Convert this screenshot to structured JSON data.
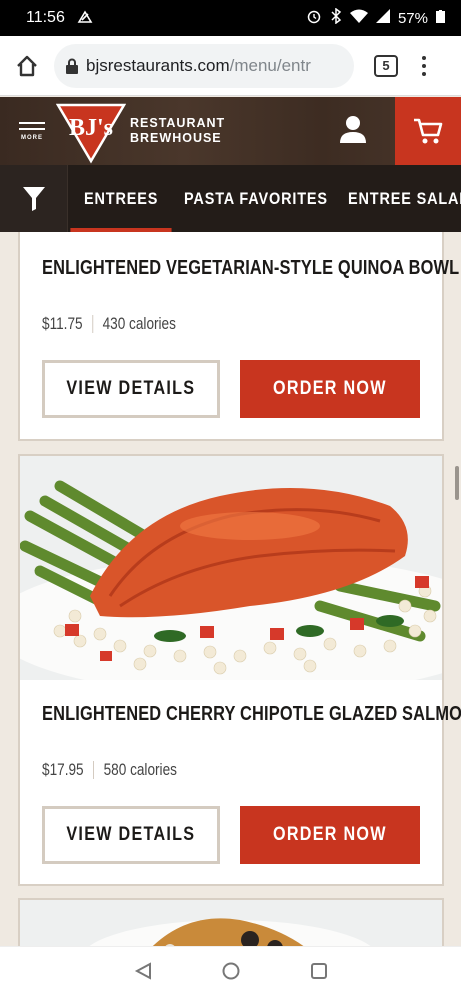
{
  "status_bar": {
    "time": "11:56",
    "battery": "57%"
  },
  "browser": {
    "url_domain": "bjsrestaurants.com",
    "url_path": "/menu/entr",
    "tab_count": "5"
  },
  "header": {
    "more_label": "MORE",
    "logo_text": "BJ's",
    "brand_line1": "RESTAURANT",
    "brand_line2": "BREWHOUSE"
  },
  "categories": [
    {
      "label": "ENTREES",
      "active": true
    },
    {
      "label": "PASTA FAVORITES",
      "active": false
    },
    {
      "label": "ENTREE SALADS",
      "active": false
    }
  ],
  "menu_items": [
    {
      "name": "ENLIGHTENED VEGETARIAN-STYLE QUINOA BOWL",
      "price": "$11.75",
      "calories": "430 calories",
      "details_label": "VIEW DETAILS",
      "order_label": "ORDER NOW"
    },
    {
      "name": "ENLIGHTENED CHERRY CHIPOTLE GLAZED SALMON*",
      "price": "$17.95",
      "calories": "580 calories",
      "details_label": "VIEW DETAILS",
      "order_label": "ORDER NOW"
    }
  ],
  "colors": {
    "brand_red": "#c8351f",
    "header_brown": "#3a2a21",
    "nav_dark": "#231c18",
    "page_bg": "#efe9e1"
  }
}
